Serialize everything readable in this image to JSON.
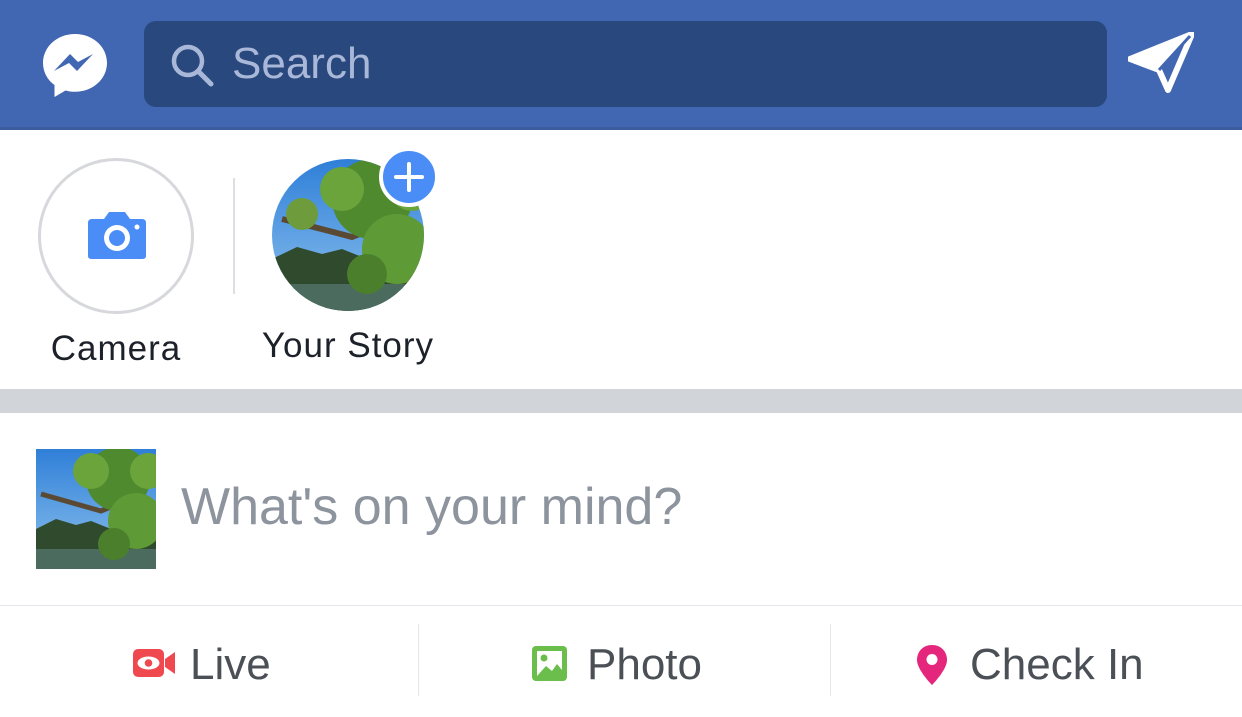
{
  "topbar": {
    "messenger_icon": "messenger-icon",
    "search_icon": "search-icon",
    "search_placeholder": "Search",
    "send_icon": "paper-plane-icon",
    "bar_color": "#4267b2",
    "search_bg_color": "#29487d"
  },
  "stories": {
    "camera": {
      "label": "Camera",
      "icon": "camera-icon"
    },
    "your_story": {
      "label": "Your Story",
      "add_icon": "plus-icon"
    },
    "accent_color": "#4a8df6"
  },
  "composer": {
    "prompt": "What's on your mind?"
  },
  "actions": [
    {
      "label": "Live",
      "icon": "live-video-icon",
      "color": "#f0484f"
    },
    {
      "label": "Photo",
      "icon": "photo-icon",
      "color": "#6bbd4c"
    },
    {
      "label": "Check In",
      "icon": "location-pin-icon",
      "color": "#e4277c"
    }
  ]
}
